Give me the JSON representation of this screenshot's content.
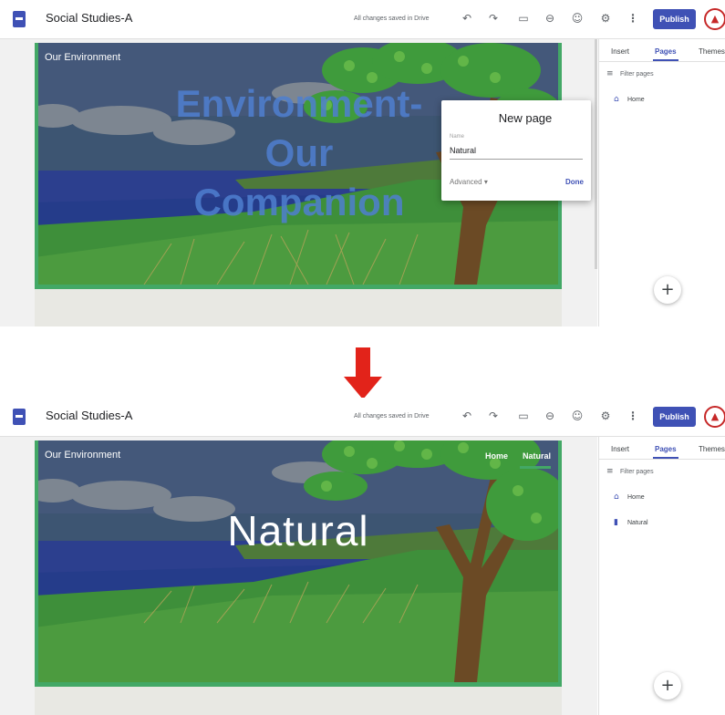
{
  "before": {
    "header": {
      "title": "Social Studies-A",
      "save_status": "All changes saved in Drive",
      "publish_label": "Publish"
    },
    "banner": {
      "site_name": "Our Environment",
      "title_lines": [
        "Environment-",
        "Our",
        "Companion"
      ]
    },
    "dialog": {
      "title": "New page",
      "name_label": "Name",
      "name_value": "Natural",
      "advanced_label": "Advanced",
      "done_label": "Done"
    },
    "panel": {
      "tabs": [
        "Insert",
        "Pages",
        "Themes"
      ],
      "active_tab": "Pages",
      "filter_placeholder": "Filter pages",
      "pages": [
        "Home"
      ]
    }
  },
  "after": {
    "header": {
      "title": "Social Studies-A",
      "save_status": "All changes saved in Drive",
      "publish_label": "Publish"
    },
    "banner": {
      "site_name": "Our Environment",
      "nav": [
        "Home",
        "Natural"
      ],
      "active_nav": "Natural",
      "page_title": "Natural"
    },
    "panel": {
      "tabs": [
        "Insert",
        "Pages",
        "Themes"
      ],
      "active_tab": "Pages",
      "filter_placeholder": "Filter pages",
      "pages": [
        "Home",
        "Natural"
      ]
    }
  },
  "icons": {
    "doc": "sites-doc-icon",
    "undo": "undo-icon",
    "redo": "redo-icon",
    "preview": "device-preview-icon",
    "link": "link-icon",
    "share": "add-person-icon",
    "settings": "gear-icon",
    "more": "more-vert-icon",
    "filter": "filter-icon",
    "home": "home-icon",
    "page": "page-icon",
    "add": "plus-icon",
    "transition": "down-arrow-icon"
  },
  "colors": {
    "accent": "#3f51b5",
    "banner_green": "#43a866",
    "arrow_red": "#e2231a",
    "title_blue": "#4f7fd0"
  }
}
